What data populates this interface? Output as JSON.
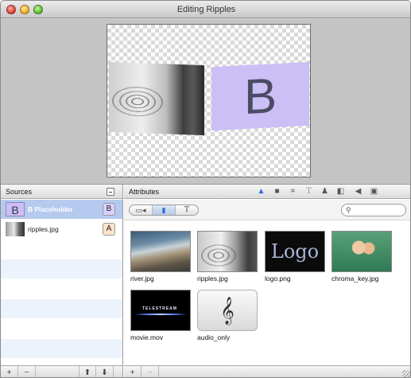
{
  "window": {
    "title": "Editing Ripples"
  },
  "preview": {
    "placeholder_letter": "B"
  },
  "sources": {
    "header": "Sources",
    "items": [
      {
        "thumb": "B",
        "name": "B Placeholder",
        "tag": "B",
        "selected": true
      },
      {
        "thumb": "",
        "name": "ripples.jpg",
        "tag": "A",
        "selected": false
      }
    ],
    "footer_buttons": [
      "+",
      "−",
      "⬆",
      "⬇"
    ]
  },
  "attributes": {
    "header": "Attributes",
    "header_icons": [
      "shapes-icon",
      "folder-icon",
      "crop-icon",
      "text-icon",
      "person-icon",
      "layout-icon",
      "speaker-icon",
      "settings-icon"
    ],
    "filters": {
      "video": "▭◂",
      "image": "▮",
      "text": "T"
    },
    "search_placeholder": "",
    "media": [
      {
        "name": "river.jpg",
        "kind": "image"
      },
      {
        "name": "ripples.jpg",
        "kind": "image"
      },
      {
        "name": "logo.png",
        "kind": "image",
        "thumb_text": "Logo"
      },
      {
        "name": "chroma_key.jpg",
        "kind": "image"
      },
      {
        "name": "movie.mov",
        "kind": "video",
        "thumb_text": "TELESTREAM"
      },
      {
        "name": "audio_only",
        "kind": "audio",
        "thumb_text": "𝄞"
      }
    ],
    "footer_buttons": [
      "+",
      "−"
    ]
  }
}
